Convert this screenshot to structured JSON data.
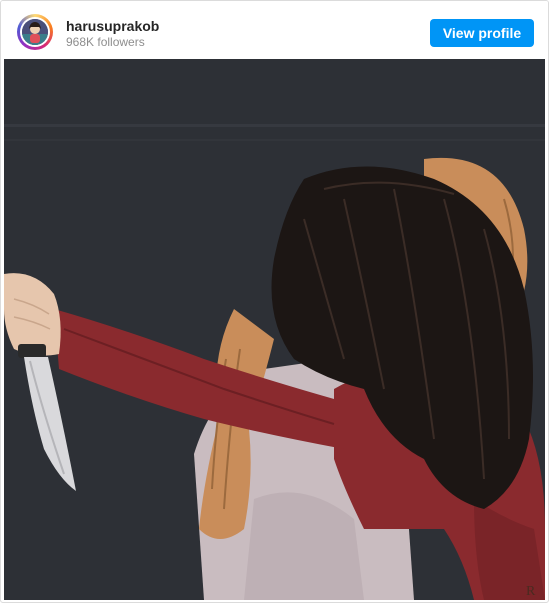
{
  "post": {
    "username": "harusuprakob",
    "followers": "968K followers",
    "view_profile_label": "View profile",
    "image_subject": "illustration of two people hugging, one holding a knife behind the other's back",
    "image_signature": "R",
    "avatar_icon": "user-avatar-icon"
  },
  "colors": {
    "button_blue": "#0095f6",
    "image_background": "#2d3036",
    "sweater_red": "#8a2a2e",
    "blonde_hair": "#c98d5a",
    "dark_hair": "#1c1614"
  }
}
